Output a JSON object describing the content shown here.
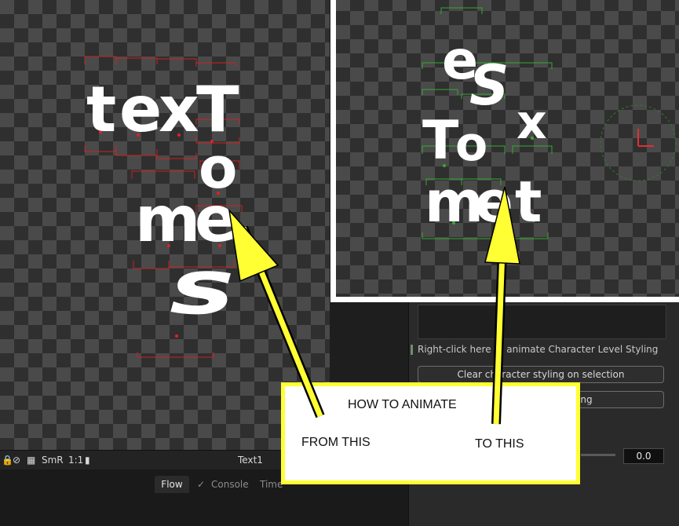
{
  "viewer_left": {
    "glyphs": [
      "t",
      "e",
      "x",
      "T",
      "o",
      "m",
      "e",
      "s"
    ]
  },
  "viewer_right": {
    "glyphs": [
      "e",
      "S",
      "x",
      "T",
      "o",
      "m",
      "e",
      "t"
    ]
  },
  "toolbar": {
    "smr_label": "SmR",
    "ratio_label": "1:1",
    "node_name": "Text1"
  },
  "tabs": {
    "flow": "Flow",
    "console": "Console",
    "timeline": "Time"
  },
  "inspector": {
    "char_level_label": "Right-click here to animate Character Level Styling",
    "clear_button_label": "Clear character styling on selection",
    "second_button_label": "ing",
    "value": "0.0"
  },
  "callout": {
    "title": "HOW TO ANIMATE",
    "from_label": "FROM THIS",
    "to_label": "TO THIS"
  },
  "colors": {
    "accent_yellow": "#ffff33",
    "left_bbox": "#cc2222",
    "right_bbox": "#33aa33"
  }
}
